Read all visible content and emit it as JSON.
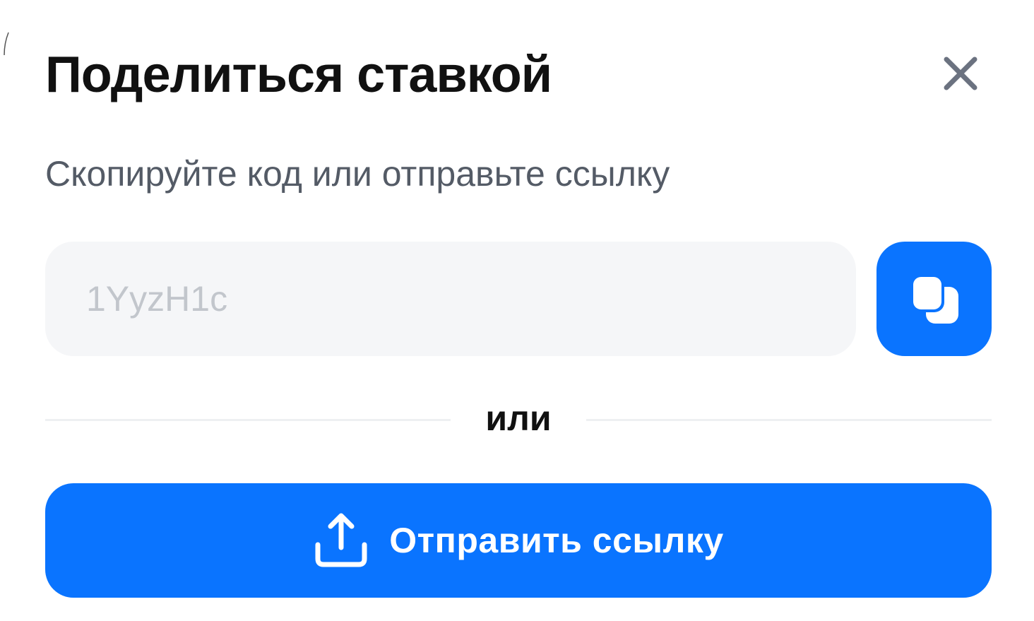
{
  "dialog": {
    "title": "Поделиться ставкой",
    "subtitle": "Скопируйте код или отправьте ссылку",
    "close_icon": "close-icon"
  },
  "code_field": {
    "placeholder": "1YyzH1c",
    "value": ""
  },
  "copy_button": {
    "icon": "copy-icon"
  },
  "divider": {
    "label": "или"
  },
  "share_button": {
    "icon": "share-upload-icon",
    "label": "Отправить ссылку"
  },
  "colors": {
    "accent": "#0a74ff",
    "title": "#111111",
    "subtitle": "#545b66",
    "field_bg": "#f5f6f8",
    "placeholder": "#c2c6cc",
    "close_icon": "#6b7280"
  }
}
